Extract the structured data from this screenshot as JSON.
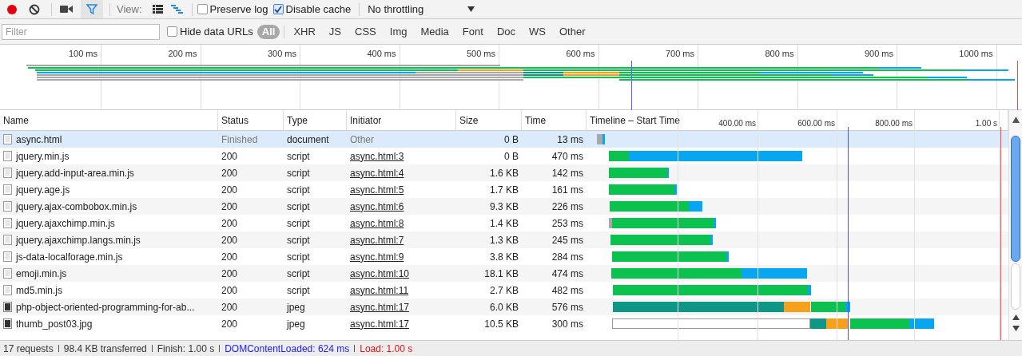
{
  "toolbar": {
    "recording": true,
    "filter_active": true,
    "view_label": "View:",
    "views": [
      {
        "kind": "list",
        "selected": false
      },
      {
        "kind": "waterfall",
        "selected": true
      }
    ],
    "checkboxes": [
      {
        "label": "Preserve log",
        "checked": false
      },
      {
        "label": "Disable cache",
        "checked": true
      }
    ],
    "throttling": {
      "value": "No throttling"
    }
  },
  "filter_bar": {
    "placeholder": "Filter",
    "hide_data_urls": {
      "label": "Hide data URLs",
      "checked": false
    },
    "types": [
      {
        "label": "All",
        "selected": true
      },
      {
        "label": "XHR",
        "selected": false
      },
      {
        "label": "JS",
        "selected": false
      },
      {
        "label": "CSS",
        "selected": false
      },
      {
        "label": "Img",
        "selected": false
      },
      {
        "label": "Media",
        "selected": false
      },
      {
        "label": "Font",
        "selected": false
      },
      {
        "label": "Doc",
        "selected": false
      },
      {
        "label": "WS",
        "selected": false
      },
      {
        "label": "Other",
        "selected": false
      }
    ]
  },
  "overview": {
    "ticks": [
      "100 ms",
      "200 ms",
      "300 ms",
      "400 ms",
      "500 ms",
      "600 ms",
      "700 ms",
      "800 ms",
      "900 ms",
      "1000 ms"
    ]
  },
  "table": {
    "columns": [
      "Name",
      "Status",
      "Type",
      "Initiator",
      "Size",
      "Time",
      "Timeline – Start Time"
    ],
    "timeline_ticks": [
      "400.00 ms",
      "600.00 ms",
      "800.00 ms",
      "1.00 s"
    ],
    "rows": [
      {
        "name": "async.html",
        "kind": "document",
        "status": "Finished",
        "type": "document",
        "initiator": "Other",
        "initiator_is_link": false,
        "size": "0 B",
        "time": "13 ms",
        "selected": true
      },
      {
        "name": "jquery.min.js",
        "kind": "document",
        "status": "200",
        "type": "script",
        "initiator": "async.html:3",
        "initiator_is_link": true,
        "size": "0 B",
        "time": "470 ms",
        "selected": false
      },
      {
        "name": "jquery.add-input-area.min.js",
        "kind": "document",
        "status": "200",
        "type": "script",
        "initiator": "async.html:4",
        "initiator_is_link": true,
        "size": "1.6 KB",
        "time": "142 ms",
        "selected": false
      },
      {
        "name": "jquery.age.js",
        "kind": "document",
        "status": "200",
        "type": "script",
        "initiator": "async.html:5",
        "initiator_is_link": true,
        "size": "1.7 KB",
        "time": "161 ms",
        "selected": false
      },
      {
        "name": "jquery.ajax-combobox.min.js",
        "kind": "document",
        "status": "200",
        "type": "script",
        "initiator": "async.html:6",
        "initiator_is_link": true,
        "size": "9.3 KB",
        "time": "226 ms",
        "selected": false
      },
      {
        "name": "jquery.ajaxchimp.min.js",
        "kind": "document",
        "status": "200",
        "type": "script",
        "initiator": "async.html:8",
        "initiator_is_link": true,
        "size": "1.4 KB",
        "time": "253 ms",
        "selected": false
      },
      {
        "name": "jquery.ajaxchimp.langs.min.js",
        "kind": "document",
        "status": "200",
        "type": "script",
        "initiator": "async.html:7",
        "initiator_is_link": true,
        "size": "1.3 KB",
        "time": "245 ms",
        "selected": false
      },
      {
        "name": "js-data-localforage.min.js",
        "kind": "document",
        "status": "200",
        "type": "script",
        "initiator": "async.html:9",
        "initiator_is_link": true,
        "size": "3.8 KB",
        "time": "284 ms",
        "selected": false
      },
      {
        "name": "emoji.min.js",
        "kind": "document",
        "status": "200",
        "type": "script",
        "initiator": "async.html:10",
        "initiator_is_link": true,
        "size": "18.1 KB",
        "time": "474 ms",
        "selected": false
      },
      {
        "name": "md5.min.js",
        "kind": "document",
        "status": "200",
        "type": "script",
        "initiator": "async.html:11",
        "initiator_is_link": true,
        "size": "2.7 KB",
        "time": "482 ms",
        "selected": false
      },
      {
        "name": "php-object-oriented-programming-for-ab...",
        "kind": "image",
        "status": "200",
        "type": "jpeg",
        "initiator": "async.html:17",
        "initiator_is_link": true,
        "size": "6.0 KB",
        "time": "576 ms",
        "selected": false
      },
      {
        "name": "thumb_post03.jpg",
        "kind": "image",
        "status": "200",
        "type": "jpeg",
        "initiator": "async.html:17",
        "initiator_is_link": true,
        "size": "10.5 KB",
        "time": "300 ms",
        "selected": false
      }
    ]
  },
  "status_bar": [
    {
      "text": "17 requests",
      "color": "#333333"
    },
    {
      "text": "98.4 KB transferred",
      "color": "#333333"
    },
    {
      "text": "Finish: 1.00 s",
      "color": "#333333"
    },
    {
      "text": "DOMContentLoaded: 624 ms",
      "color": "#1a1aff"
    },
    {
      "text": "Load: 1.00 s",
      "color": "#e81010"
    }
  ]
}
